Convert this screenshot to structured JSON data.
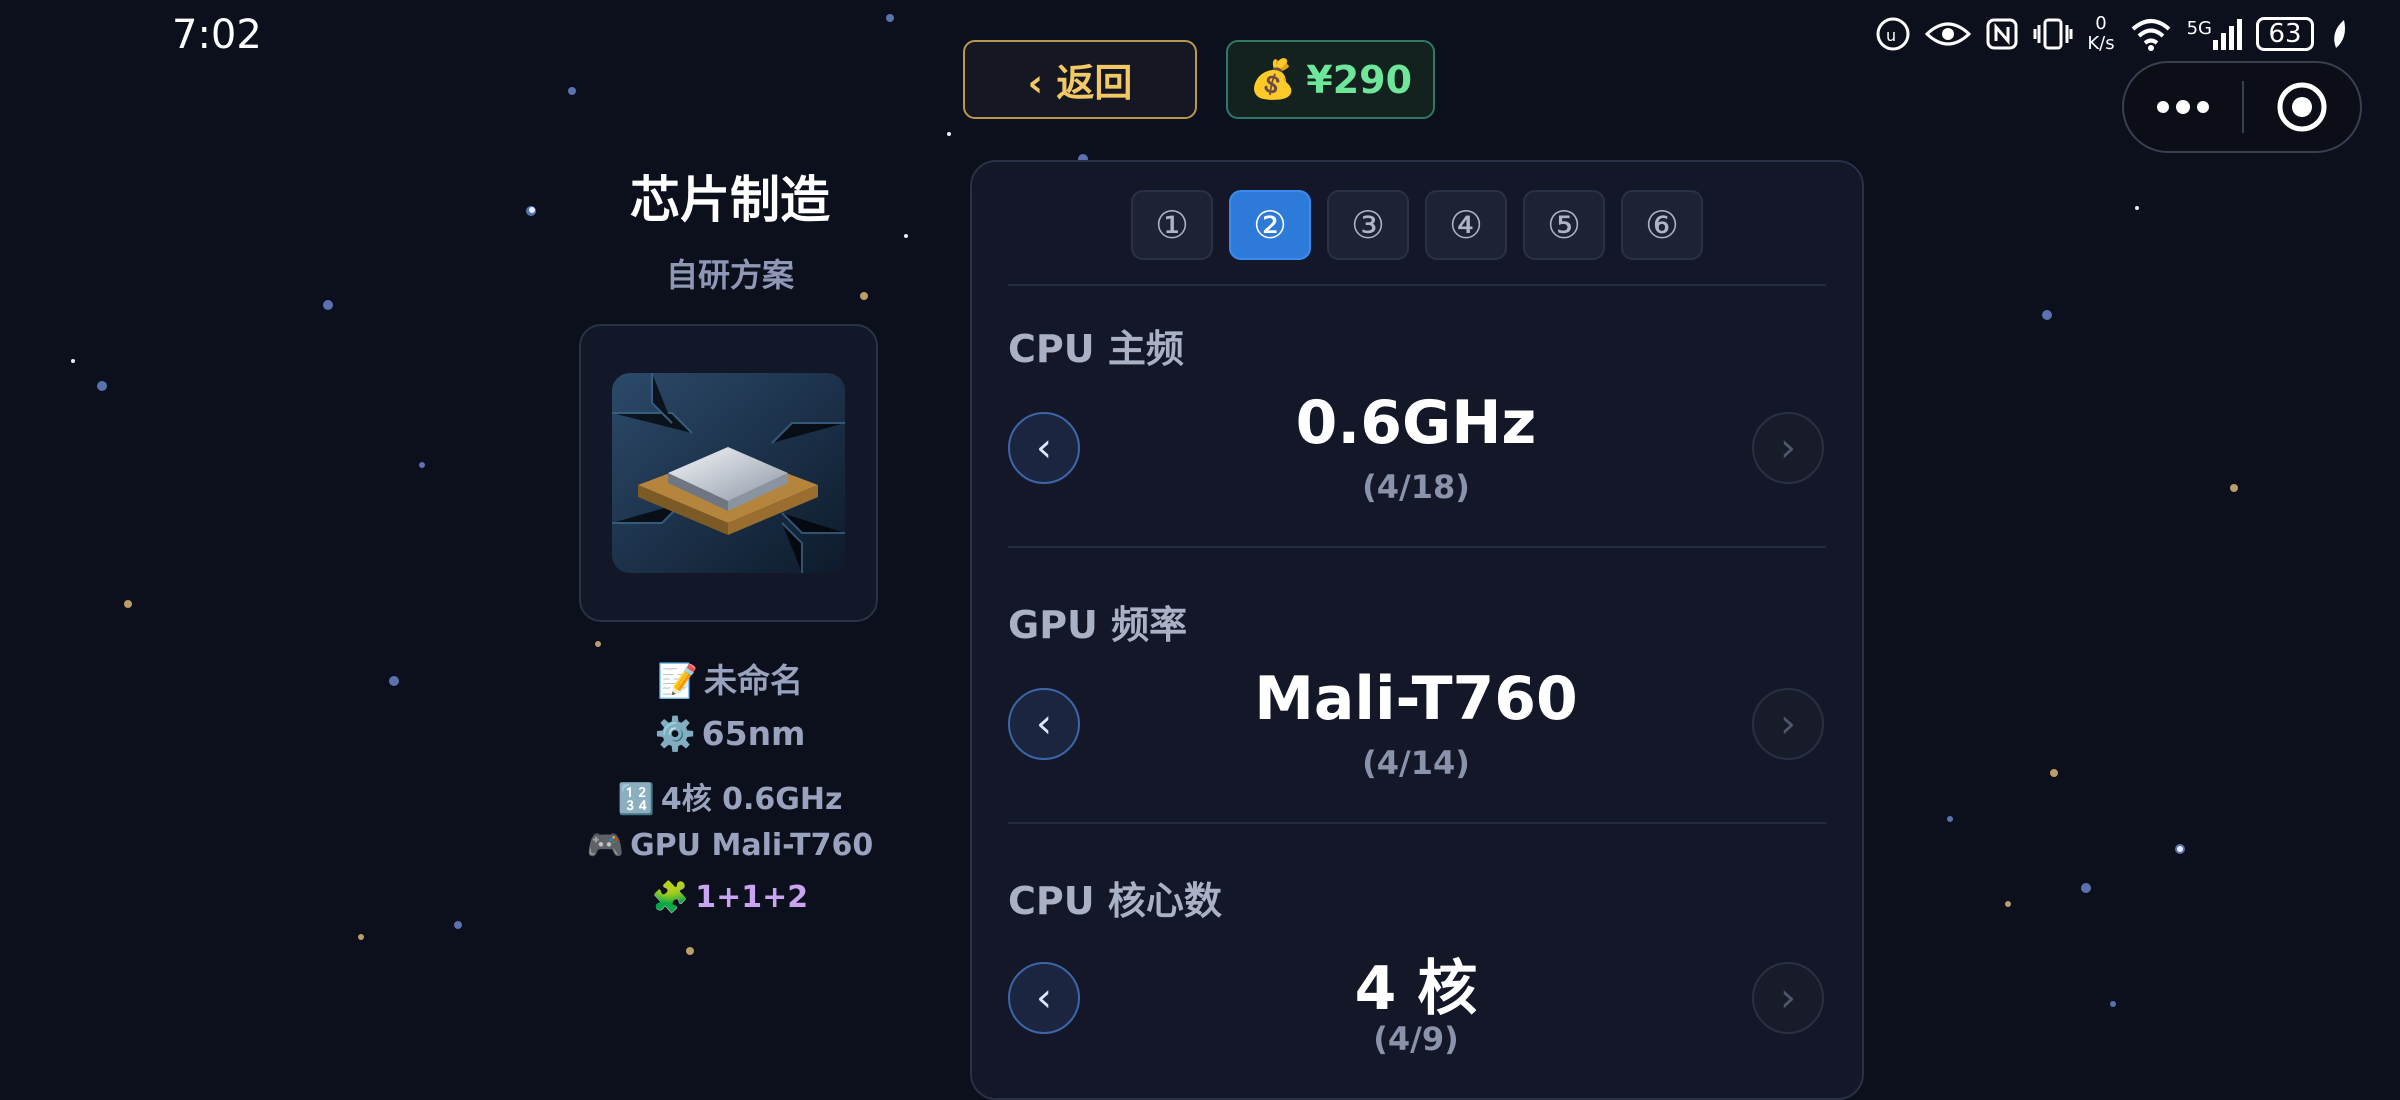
{
  "status_bar": {
    "time": "7:02",
    "net_speed_value": "0",
    "net_speed_unit": "K/s",
    "network": "5G",
    "battery": "63"
  },
  "top": {
    "back_label": "‹ 返回",
    "money_icon": "💰",
    "money": "¥290"
  },
  "chip": {
    "title": "芯片制造",
    "subtitle": "自研方案",
    "name_icon": "📝",
    "name": "未命名",
    "process_icon": "⚙️",
    "process": "65nm",
    "cores_icon": "🔢",
    "cores": "4核 0.6GHz",
    "gpu_icon": "🎮",
    "gpu": "GPU Mali-T760",
    "layout_icon": "🧩",
    "layout": "1+1+2"
  },
  "tabs": [
    "①",
    "②",
    "③",
    "④",
    "⑤",
    "⑥"
  ],
  "active_tab": 1,
  "sections": [
    {
      "label": "CPU 主频",
      "value": "0.6GHz",
      "counter": "(4/18)"
    },
    {
      "label": "GPU 频率",
      "value": "Mali-T760",
      "counter": "(4/14)"
    },
    {
      "label": "CPU 核心数",
      "value": "4 核",
      "counter": "(4/9)"
    }
  ],
  "arrows": {
    "prev": "‹",
    "next": "›"
  },
  "colors": {
    "background": "#0c0f1c",
    "accent_blue": "#2e7ad9",
    "gold": "#f3c966",
    "green": "#6ee79b"
  }
}
